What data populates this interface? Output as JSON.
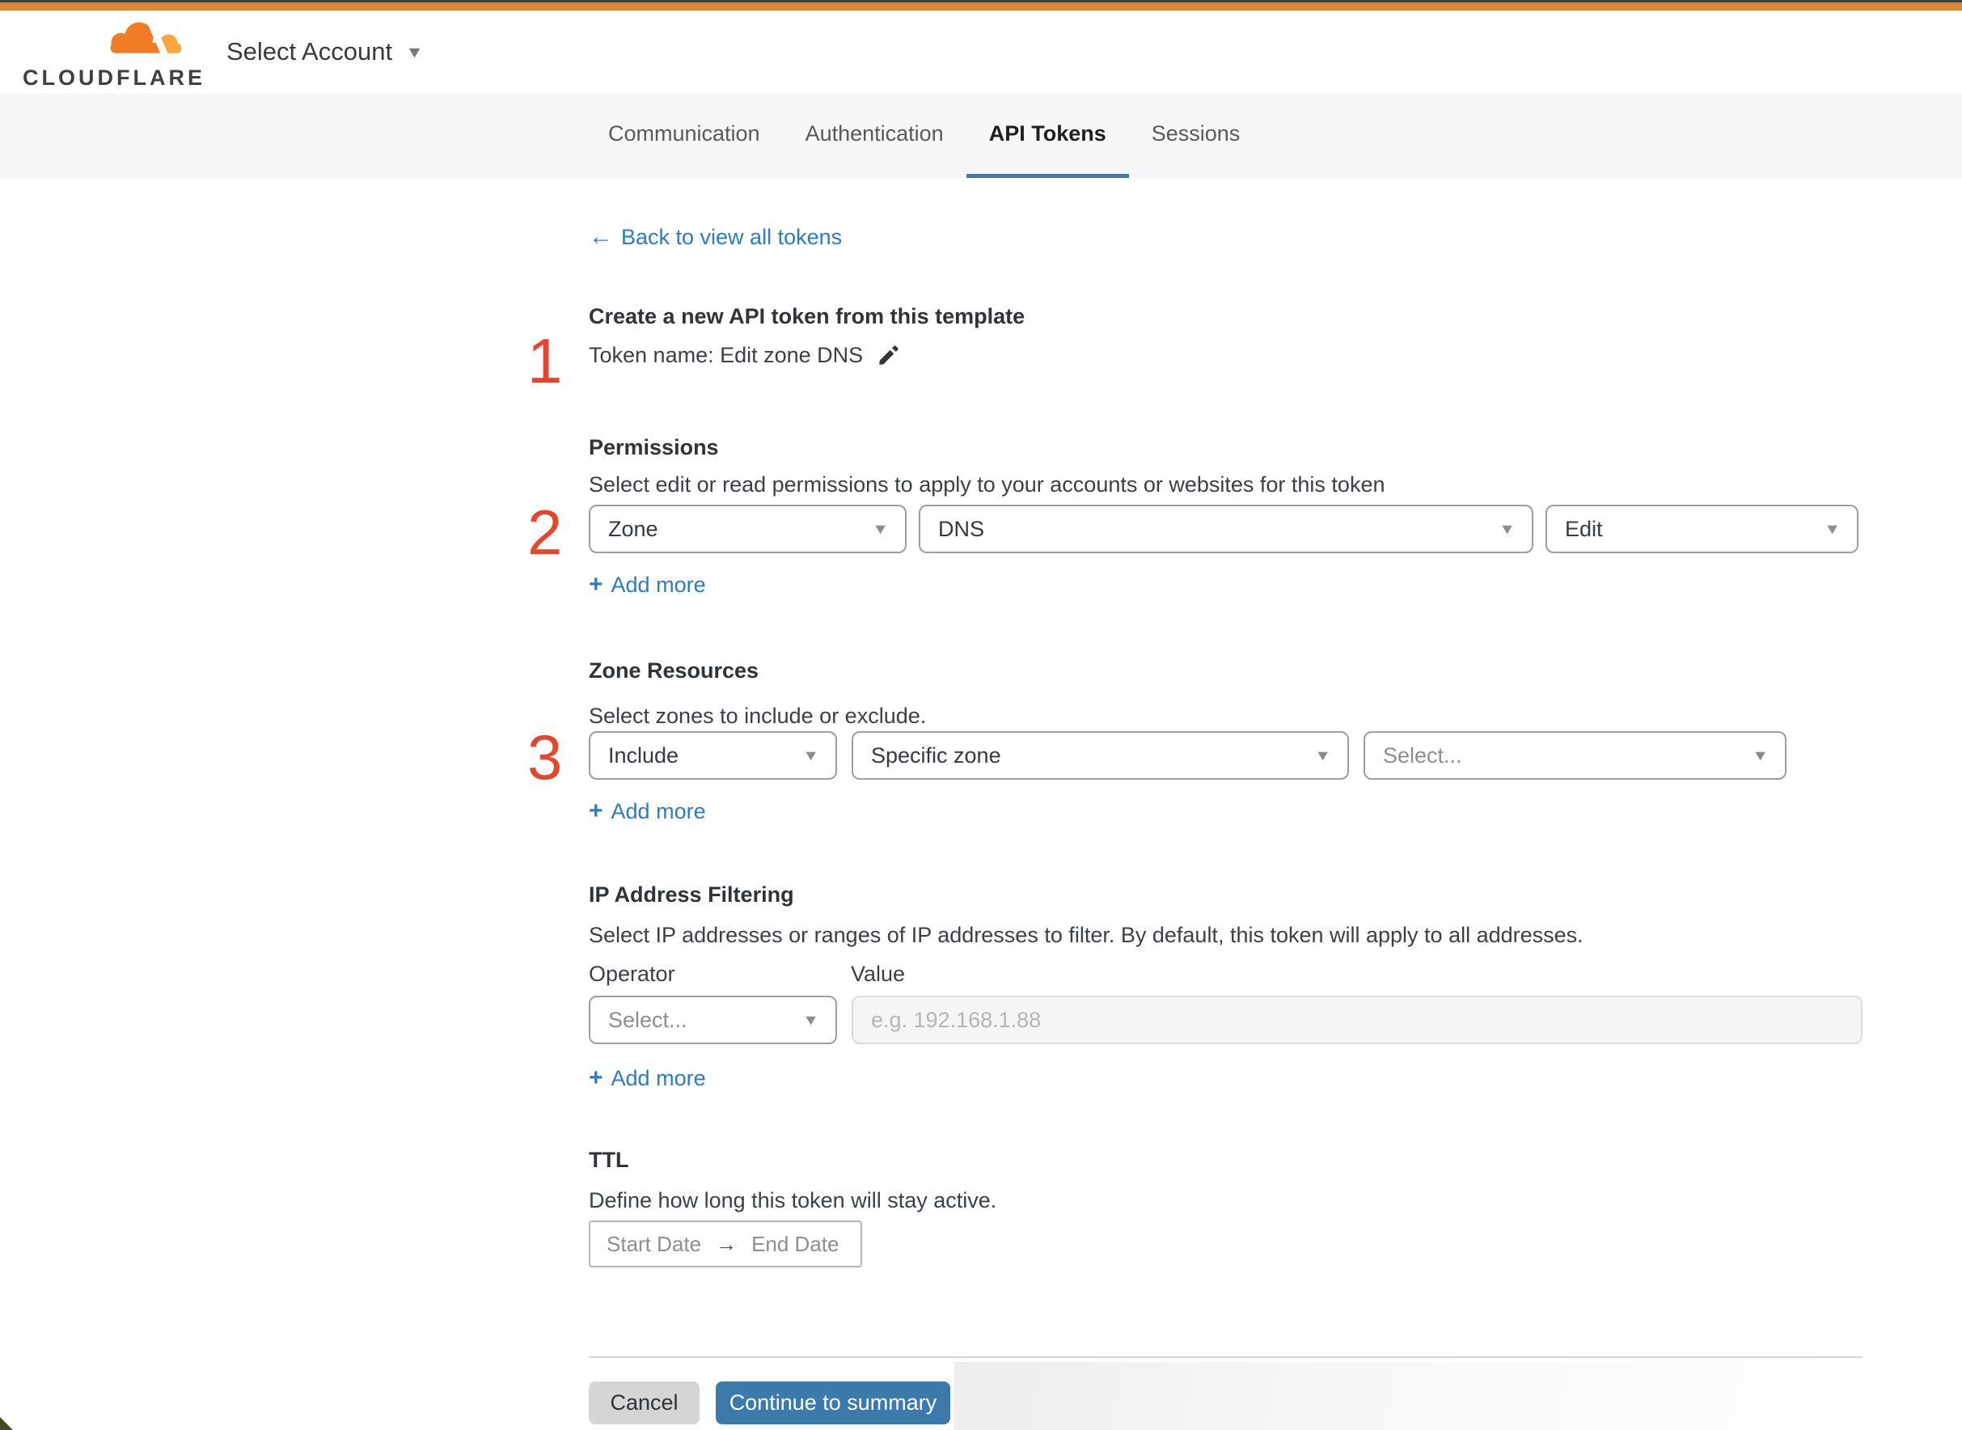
{
  "icons": {
    "back_arrow": "←",
    "caret_down": "▼",
    "plus": "+",
    "range_arrow": "→"
  },
  "colors": {
    "accent_orange": "#dd8636",
    "link_blue": "#2e7bbf",
    "button_blue": "#3d7aac",
    "step_red": "#e5462d"
  },
  "header": {
    "brand": "CLOUDFLARE",
    "account_selector_label": "Select Account"
  },
  "tabs": {
    "active": "API Tokens",
    "items": [
      {
        "label": "Communication"
      },
      {
        "label": "Authentication"
      },
      {
        "label": "API Tokens"
      },
      {
        "label": "Sessions"
      }
    ]
  },
  "back_link": {
    "label": "Back to view all tokens"
  },
  "create_section": {
    "step": "1",
    "heading": "Create a new API token from this template",
    "token_name": "Token name: Edit zone DNS"
  },
  "permissions": {
    "step": "2",
    "heading": "Permissions",
    "description": "Select edit or read permissions to apply to your accounts or websites for this token",
    "scope_value": "Zone",
    "service_value": "DNS",
    "access_value": "Edit",
    "add_more_label": "Add more"
  },
  "zone_resources": {
    "step": "3",
    "heading": "Zone Resources",
    "description": "Select zones to include or exclude.",
    "mode_value": "Include",
    "type_value": "Specific zone",
    "zone_placeholder": "Select...",
    "add_more_label": "Add more"
  },
  "ip_filtering": {
    "heading": "IP Address Filtering",
    "description": "Select IP addresses or ranges of IP addresses to filter. By default, this token will apply to all addresses.",
    "operator_label": "Operator",
    "value_label": "Value",
    "operator_placeholder": "Select...",
    "value_placeholder": "e.g. 192.168.1.88",
    "add_more_label": "Add more"
  },
  "ttl": {
    "heading": "TTL",
    "description": "Define how long this token will stay active.",
    "start_placeholder": "Start Date",
    "end_placeholder": "End Date"
  },
  "footer": {
    "cancel_label": "Cancel",
    "continue_label": "Continue to summary"
  }
}
